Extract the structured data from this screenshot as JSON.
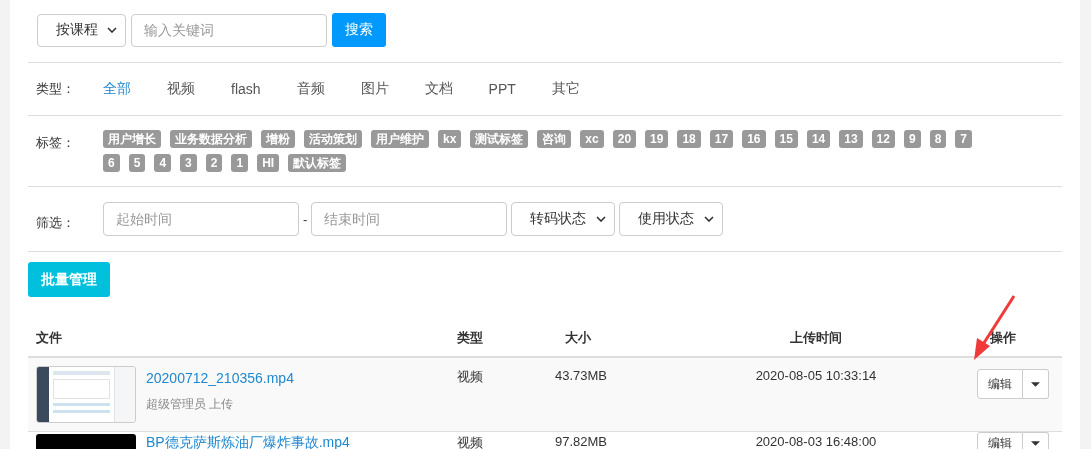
{
  "search": {
    "scope_select": "按课程",
    "placeholder": "输入关键词",
    "button": "搜索"
  },
  "type_filter": {
    "label": "类型：",
    "options": [
      {
        "label": "全部",
        "selected": true
      },
      {
        "label": "视频",
        "selected": false
      },
      {
        "label": "flash",
        "selected": false
      },
      {
        "label": "音频",
        "selected": false
      },
      {
        "label": "图片",
        "selected": false
      },
      {
        "label": "文档",
        "selected": false
      },
      {
        "label": "PPT",
        "selected": false
      },
      {
        "label": "其它",
        "selected": false
      }
    ]
  },
  "tags": {
    "label": "标签：",
    "items": [
      "用户增长",
      "业务数据分析",
      "增粉",
      "活动策划",
      "用户维护",
      "kx",
      "测试标签",
      "咨询",
      "xc",
      "20",
      "19",
      "18",
      "17",
      "16",
      "15",
      "14",
      "13",
      "12",
      "9",
      "8",
      "7",
      "6",
      "5",
      "4",
      "3",
      "2",
      "1",
      "HI",
      "默认标签"
    ]
  },
  "filters": {
    "label": "筛选：",
    "start_placeholder": "起始时间",
    "separator": "-",
    "end_placeholder": "结束时间",
    "selects": [
      "转码状态",
      "使用状态"
    ]
  },
  "batch_button": "批量管理",
  "table": {
    "columns": [
      "文件",
      "类型",
      "大小",
      "上传时间",
      "操作"
    ],
    "rows": [
      {
        "kind": "screenshot",
        "name": "20200712_210356.mp4",
        "uploader": "超级管理员 上传",
        "type": "视频",
        "size": "43.73MB",
        "time": "2020-08-05 10:33:14",
        "action": "编辑"
      },
      {
        "kind": "dark",
        "name": "BP德克萨斯炼油厂爆炸事故.mp4",
        "type": "视频",
        "size": "97.82MB",
        "time": "2020-08-03 16:48:00",
        "action": "编辑"
      }
    ]
  }
}
